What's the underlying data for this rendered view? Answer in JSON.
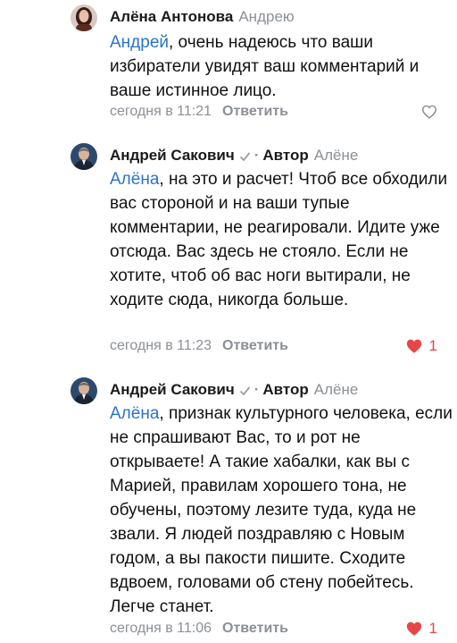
{
  "comments": [
    {
      "author": "Алёна Антонова",
      "reply_to": "Андрею",
      "mention": "Андрей",
      "text": ", очень надеюсь  что ваши избиратели увидят ваш комментарий и ваше истинное лицо.",
      "time": "сегодня в 11:21",
      "reply_label": "Ответить",
      "likes": ""
    },
    {
      "author": "Андрей Сакович",
      "badge": "Автор",
      "reply_to": "Алёне",
      "mention": "Алёна",
      "text": ", на это и расчет! Чтоб все обходили вас стороной и на ваши тупые комментарии, не реагировали. Идите уже отсюда. Вас здесь не стояло. Если не хотите, чтоб об вас ноги вытирали, не ходите сюда, никогда больше.",
      "time": "сегодня в 11:23",
      "reply_label": "Ответить",
      "likes": "1"
    },
    {
      "author": "Андрей Сакович",
      "badge": "Автор",
      "reply_to": "Алёне",
      "mention": "Алёна",
      "text": ", признак культурного человека, если не спрашивают Вас, то и рот не открываете! А такие хабалки, как вы с Марией, правилам хорошего тона, не обучены, поэтому лезите туда, куда не звали. Я людей поздравляю с Новым годом, а вы пакости пишите. Сходите вдвоем, головами об стену побейтесь. Легче станет.",
      "time": "сегодня в 11:06",
      "reply_label": "Ответить",
      "likes": "1"
    }
  ],
  "colors": {
    "link": "#2a74c9",
    "muted": "#8b8f96",
    "like": "#e64646"
  },
  "icons": {
    "verified": "checkmark-icon",
    "like_empty": "heart-outline-icon",
    "like_filled": "heart-filled-icon"
  }
}
